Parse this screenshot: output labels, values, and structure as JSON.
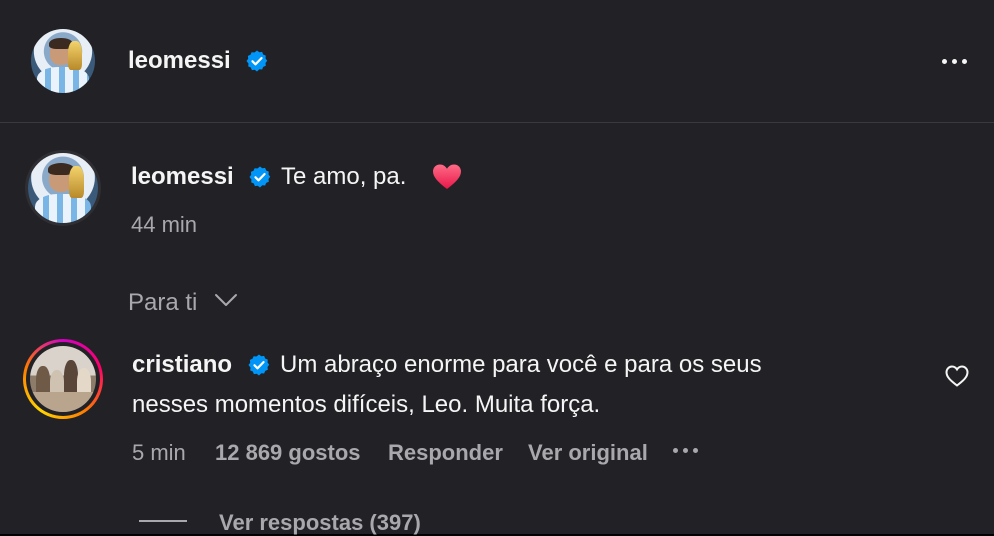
{
  "header": {
    "username": "leomessi",
    "verified_icon": "verified-badge-icon",
    "more_icon": "more-options-icon"
  },
  "caption": {
    "username": "leomessi",
    "text": "Te amo, pa.",
    "emoji": "heart-emoji",
    "time": "44 min"
  },
  "filter": {
    "label": "Para ti",
    "icon": "chevron-down-icon"
  },
  "comment": {
    "username": "cristiano",
    "line1": "Um abraço enorme para você e para os seus",
    "line2": "nesses momentos difíceis, Leo. Muita força.",
    "time": "5 min",
    "likes": "12 869 gostos",
    "reply": "Responder",
    "see_original": "Ver original",
    "more_icon": "more-options-icon",
    "like_icon": "heart-outline-icon",
    "view_replies": "Ver respostas (397)"
  },
  "colors": {
    "background": "#222226",
    "verified": "#0095f6",
    "secondary_text": "#a8a8ad",
    "heart": "#ff3b5c"
  }
}
